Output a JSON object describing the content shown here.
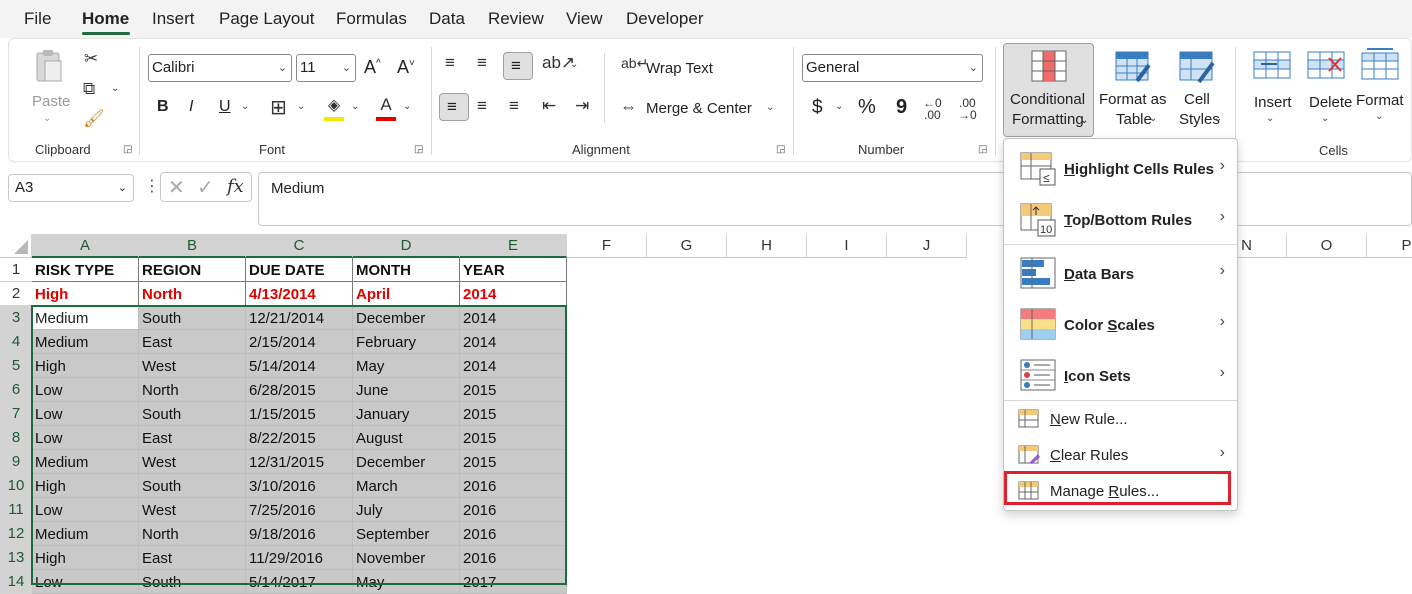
{
  "menu": {
    "tabs": [
      "File",
      "Home",
      "Insert",
      "Page Layout",
      "Formulas",
      "Data",
      "Review",
      "View",
      "Developer"
    ],
    "active_tab": "Home"
  },
  "ribbon": {
    "clipboard": {
      "paste": "Paste",
      "label": "Clipboard"
    },
    "font": {
      "name": "Calibri",
      "size": "11",
      "grow": "A^",
      "shrink": "A˅",
      "bold": "B",
      "italic": "I",
      "underline": "U",
      "label": "Font"
    },
    "alignment": {
      "wrap_text": "Wrap Text",
      "merge_center": "Merge & Center",
      "label": "Alignment"
    },
    "number": {
      "format": "General",
      "currency": "$",
      "percent": "%",
      "comma": "9",
      "label": "Number"
    },
    "styles": {
      "conditional_formatting_1": "Conditional",
      "conditional_formatting_2": "Formatting",
      "format_table_1": "Format as",
      "format_table_2": "Table",
      "cell_styles_1": "Cell",
      "cell_styles_2": "Styles"
    },
    "cells": {
      "insert": "Insert",
      "delete": "Delete",
      "format": "Format",
      "label": "Cells"
    }
  },
  "formula_bar": {
    "name_box": "A3",
    "fx": "fx",
    "value": "Medium"
  },
  "grid": {
    "columns": [
      "A",
      "B",
      "C",
      "D",
      "E",
      "F",
      "G",
      "H",
      "I",
      "J",
      "N",
      "O",
      "P"
    ],
    "row_numbers": [
      "1",
      "2",
      "3",
      "4",
      "5",
      "6",
      "7",
      "8",
      "9",
      "10",
      "11",
      "12",
      "13",
      "14"
    ],
    "header_row": [
      "RISK TYPE",
      "REGION",
      "DUE DATE",
      "MONTH",
      "YEAR"
    ],
    "highlight_row": [
      "High",
      "North",
      "4/13/2014",
      "April",
      "2014"
    ],
    "rows": [
      [
        "Medium",
        "South",
        "12/21/2014",
        "December",
        "2014"
      ],
      [
        "Medium",
        "East",
        "2/15/2014",
        "February",
        "2014"
      ],
      [
        "High",
        "West",
        "5/14/2014",
        "May",
        "2014"
      ],
      [
        "Low",
        "North",
        "6/28/2015",
        "June",
        "2015"
      ],
      [
        "Low",
        "South",
        "1/15/2015",
        "January",
        "2015"
      ],
      [
        "Low",
        "East",
        "8/22/2015",
        "August",
        "2015"
      ],
      [
        "Medium",
        "West",
        "12/31/2015",
        "December",
        "2015"
      ],
      [
        "High",
        "South",
        "3/10/2016",
        "March",
        "2016"
      ],
      [
        "Low",
        "West",
        "7/25/2016",
        "July",
        "2016"
      ],
      [
        "Medium",
        "North",
        "9/18/2016",
        "September",
        "2016"
      ],
      [
        "High",
        "East",
        "11/29/2016",
        "November",
        "2016"
      ],
      [
        "Low",
        "South",
        "5/14/2017",
        "May",
        "2017"
      ]
    ]
  },
  "cf_menu": {
    "highlight_cells": "Highlight Cells Rules",
    "top_bottom": "Top/Bottom Rules",
    "data_bars": "Data Bars",
    "color_scales": "Color Scales",
    "icon_sets": "Icon Sets",
    "new_rule": "New Rule...",
    "clear_rules": "Clear Rules",
    "manage_rules": "Manage Rules..."
  },
  "colors": {
    "accent": "#1e6b3c",
    "highlight_red": "#e30000",
    "selection_gray": "#c9c9c9",
    "callout_red": "#e0202c"
  }
}
